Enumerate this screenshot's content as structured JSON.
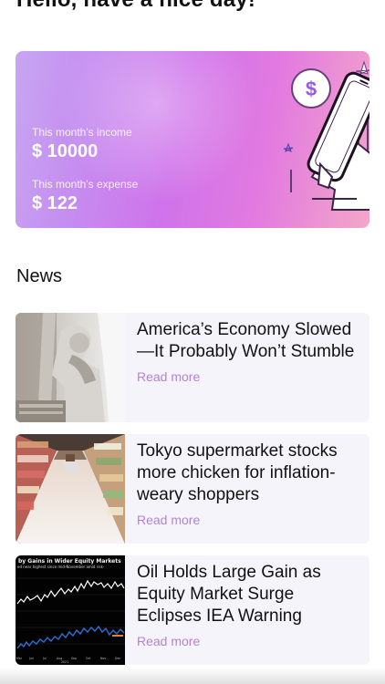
{
  "greeting": "Hello, have a nice day!",
  "summary_card": {
    "income_label": "This month's income",
    "income_value": "$ 10000",
    "expense_label": "This month's expense",
    "expense_value": "$ 122",
    "illustration_icon": "hand-holding-phone-with-dollar-coin-icon",
    "colors": {
      "gradient_start": "#c7a6f2",
      "gradient_mid": "#cf73ea",
      "gradient_end": "#f3a7c8"
    }
  },
  "news": {
    "heading": "News",
    "items": [
      {
        "title": "America’s Economy Slowed—It Probably Won’t Stumble",
        "read_more": "Read more",
        "image": "statue-photo"
      },
      {
        "title": "Tokyo supermarket stocks more chicken for inflation-weary shoppers",
        "read_more": "Read more",
        "image": "supermarket-aisle-photo"
      },
      {
        "title": "Oil Holds Large Gain as Equity Market Surge Eclipses IEA Warning",
        "read_more": "Read more",
        "image": "market-chart-photo",
        "image_caption_line_1": "by Gains in Wider Equity Markets",
        "image_caption_line_2": "ed near highest since mid-November amid risk-"
      }
    ]
  },
  "colors": {
    "read_more": "#b282d6",
    "news_card_bg": "#f6f4fb"
  }
}
